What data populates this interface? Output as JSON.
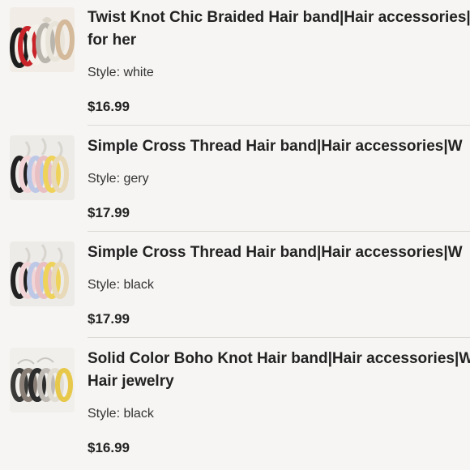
{
  "items": [
    {
      "title_line1": "Twist Knot Chic Braided Hair band|Hair accessories|W",
      "title_line2": "for her",
      "style": "Style: white",
      "price": "$16.99",
      "image": "twisted-headbands-image"
    },
    {
      "title_line1": "Simple Cross Thread Hair band|Hair accessories|W",
      "title_line2": "",
      "style": "Style: gery",
      "price": "$17.99",
      "image": "braided-headbands-image"
    },
    {
      "title_line1": "Simple Cross Thread Hair band|Hair accessories|W",
      "title_line2": "",
      "style": "Style: black",
      "price": "$17.99",
      "image": "braided-headbands-image"
    },
    {
      "title_line1": "Solid Color Boho Knot Hair band|Hair accessories|W",
      "title_line2": "Hair jewelry",
      "style": "Style: black",
      "price": "$16.99",
      "image": "knotted-headbands-image"
    }
  ]
}
